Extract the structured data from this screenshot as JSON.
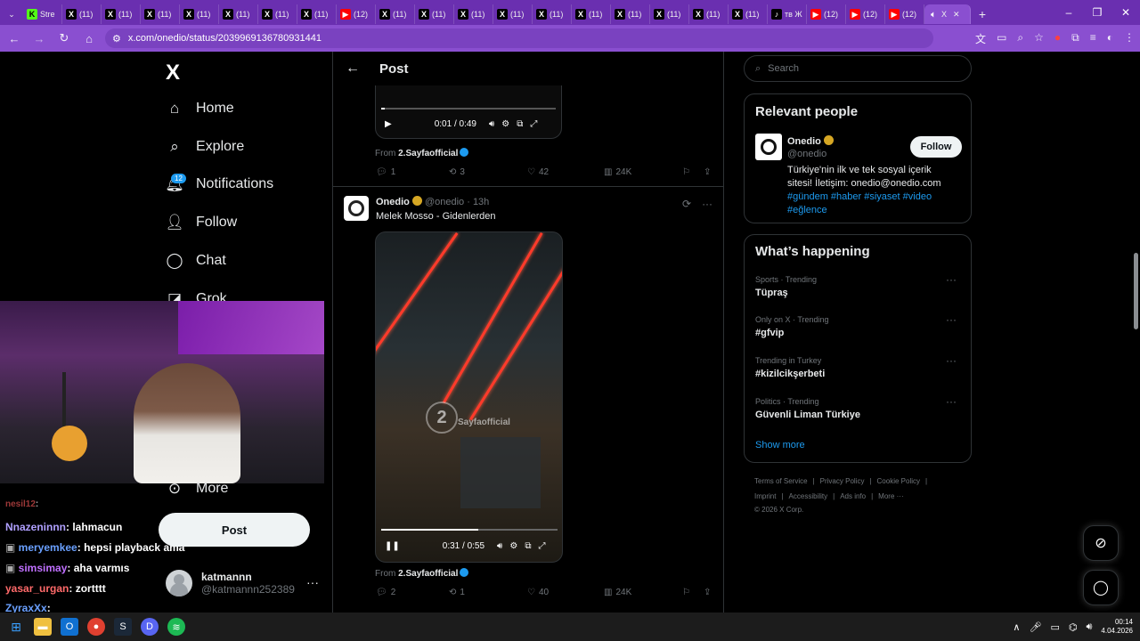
{
  "browser": {
    "tabs": [
      {
        "label": "Stre",
        "icon": "kick-icon",
        "color": "#53fc18"
      },
      {
        "label": "(11)",
        "icon": "x-icon",
        "color": "#000"
      },
      {
        "label": "(11)",
        "icon": "x-icon",
        "color": "#000"
      },
      {
        "label": "(11)",
        "icon": "x-icon",
        "color": "#000"
      },
      {
        "label": "(11)",
        "icon": "x-icon",
        "color": "#000"
      },
      {
        "label": "(11)",
        "icon": "x-icon",
        "color": "#000"
      },
      {
        "label": "(11)",
        "icon": "x-icon",
        "color": "#000"
      },
      {
        "label": "(11)",
        "icon": "x-icon",
        "color": "#000"
      },
      {
        "label": "(12)",
        "icon": "youtube-icon",
        "color": "#ff0000"
      },
      {
        "label": "(11)",
        "icon": "x-icon",
        "color": "#000"
      },
      {
        "label": "(11)",
        "icon": "x-icon",
        "color": "#000"
      },
      {
        "label": "(11)",
        "icon": "x-icon",
        "color": "#000"
      },
      {
        "label": "(11)",
        "icon": "x-icon",
        "color": "#000"
      },
      {
        "label": "(11)",
        "icon": "x-icon",
        "color": "#000"
      },
      {
        "label": "(11)",
        "icon": "x-icon",
        "color": "#000"
      },
      {
        "label": "(11)",
        "icon": "x-icon",
        "color": "#000"
      },
      {
        "label": "(11)",
        "icon": "x-icon",
        "color": "#000"
      },
      {
        "label": "(11)",
        "icon": "x-icon",
        "color": "#000"
      },
      {
        "label": "(11)",
        "icon": "x-icon",
        "color": "#000"
      },
      {
        "label": "тв Ж",
        "icon": "tiktok-icon",
        "color": "#000"
      },
      {
        "label": "(12)",
        "icon": "youtube-icon",
        "color": "#ff0000"
      },
      {
        "label": "(12)",
        "icon": "youtube-icon",
        "color": "#ff0000"
      },
      {
        "label": "(12)",
        "icon": "youtube-icon",
        "color": "#ff0000"
      }
    ],
    "url": "x.com/onedio/status/2039969136780931441",
    "accent": "#8a4fd0"
  },
  "nav": {
    "logo": "X",
    "items": [
      {
        "label": "Home",
        "icon": "home-icon"
      },
      {
        "label": "Explore",
        "icon": "search-icon"
      },
      {
        "label": "Notifications",
        "icon": "bell-icon"
      },
      {
        "label": "Follow",
        "icon": "follow-icon"
      },
      {
        "label": "Chat",
        "icon": "chat-icon"
      },
      {
        "label": "Grok",
        "icon": "grok-icon"
      },
      {
        "label": "More",
        "icon": "more-icon"
      }
    ],
    "notif_badge": "12",
    "post_button": "Post",
    "account": {
      "name": "katmannn",
      "handle": "@katmannn252389"
    }
  },
  "stream_chat": [
    {
      "user": "nesil12",
      "msg": ":",
      "color": "#e05050"
    },
    {
      "user": "Nnazeninnn",
      "msg": ": lahmacun",
      "color": "#b0a0ff"
    },
    {
      "user": "meryemkee",
      "msg": ": hepsi playback ama",
      "color": "#6aa0ff"
    },
    {
      "user": "simsimay",
      "msg": ": aha varmıs",
      "color": "#c070ff"
    },
    {
      "user": "yasar_urgan",
      "msg": ": zortttt",
      "color": "#ff6a6a"
    },
    {
      "user": "ZyraxXx",
      "msg": ":",
      "color": "#6aa0ff"
    }
  ],
  "post_header": {
    "title": "Post"
  },
  "post1": {
    "time": "0:01 / 0:49",
    "from_label": "From",
    "from": "2.Sayfaofficial",
    "replies": "1",
    "reposts": "3",
    "likes": "42",
    "views": "24K"
  },
  "post2": {
    "author": "Onedio",
    "handle": "@onedio",
    "age": "· 13h",
    "text": "Melek Mosso - Gidenlerden",
    "watermark": "Sayfaofficial",
    "watermark_num": "2",
    "time": "0:31 / 0:55",
    "progress": 0.55,
    "from_label": "From",
    "from": "2.Sayfaofficial",
    "replies": "2",
    "reposts": "1",
    "likes": "40",
    "views": "24K"
  },
  "right": {
    "search_placeholder": "Search",
    "relevant": {
      "title": "Relevant people",
      "name": "Onedio",
      "handle": "@onedio",
      "follow": "Follow",
      "bio": "Türkiye'nin ilk ve tek sosyal içerik sitesi! İletişim: onedio@onedio.com",
      "hashtags": "#gündem #haber #siyaset #video #eğlence"
    },
    "happening": {
      "title": "What’s happening",
      "trends": [
        {
          "cat": "Sports · Trending",
          "name": "Tüpraş"
        },
        {
          "cat": "Only on X · Trending",
          "name": "#gfvip"
        },
        {
          "cat": "Trending in Turkey",
          "name": "#kizilcikşerbeti"
        },
        {
          "cat": "Politics · Trending",
          "name": "Güvenli Liman Türkiye"
        }
      ],
      "show_more": "Show more"
    },
    "footer": {
      "row1": [
        "Terms of Service",
        "|",
        "Privacy Policy",
        "|",
        "Cookie Policy",
        "|"
      ],
      "row2": [
        "Imprint",
        "|",
        "Accessibility",
        "|",
        "Ads info",
        "|",
        "More ···"
      ],
      "row3": "© 2026 X Corp."
    }
  },
  "taskbar": {
    "time": "00:14",
    "date": "4.04.2026"
  }
}
